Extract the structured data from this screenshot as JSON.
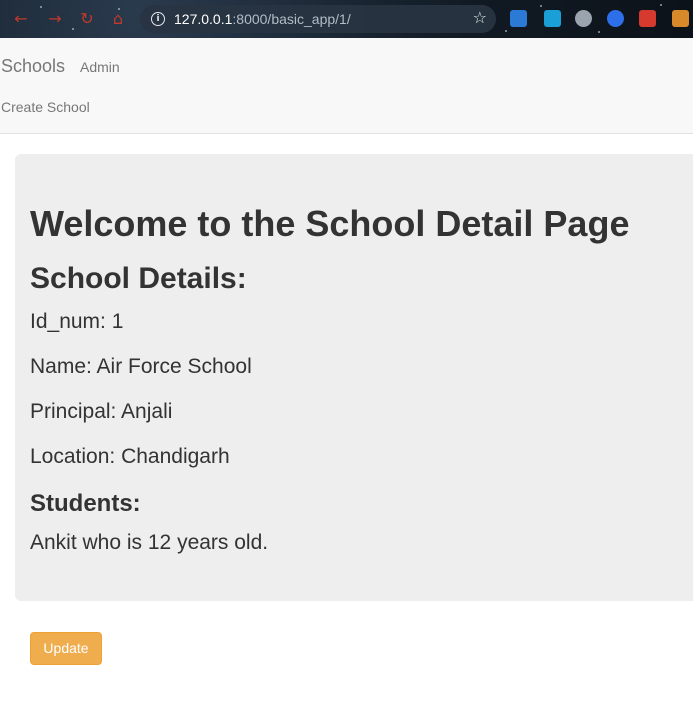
{
  "browser": {
    "url_host": "127.0.0.1",
    "url_rest": ":8000/basic_app/1/",
    "icons": [
      "back-icon",
      "forward-icon",
      "reload-icon",
      "home-icon",
      "info-icon",
      "bookmark-star-icon",
      "extension-icons"
    ]
  },
  "navbar": {
    "brand": "Schools",
    "admin_label": "Admin",
    "create_label": "Create School"
  },
  "main": {
    "title": "Welcome to the School Detail Page",
    "details_heading": "School Details:",
    "id_line": "Id_num: 1",
    "name_line": "Name: Air Force School",
    "principal_line": "Principal: Anjali",
    "location_line": "Location: Chandigarh",
    "students_heading": "Students:",
    "student_entry": "Ankit who is 12 years old."
  },
  "actions": {
    "update_label": "Update"
  },
  "colors": {
    "accent": "#f0ad4e",
    "jumbotron_bg": "#eeeeee",
    "navbar_bg": "#f8f8f8",
    "text": "#333333",
    "nav_text": "#777777"
  }
}
